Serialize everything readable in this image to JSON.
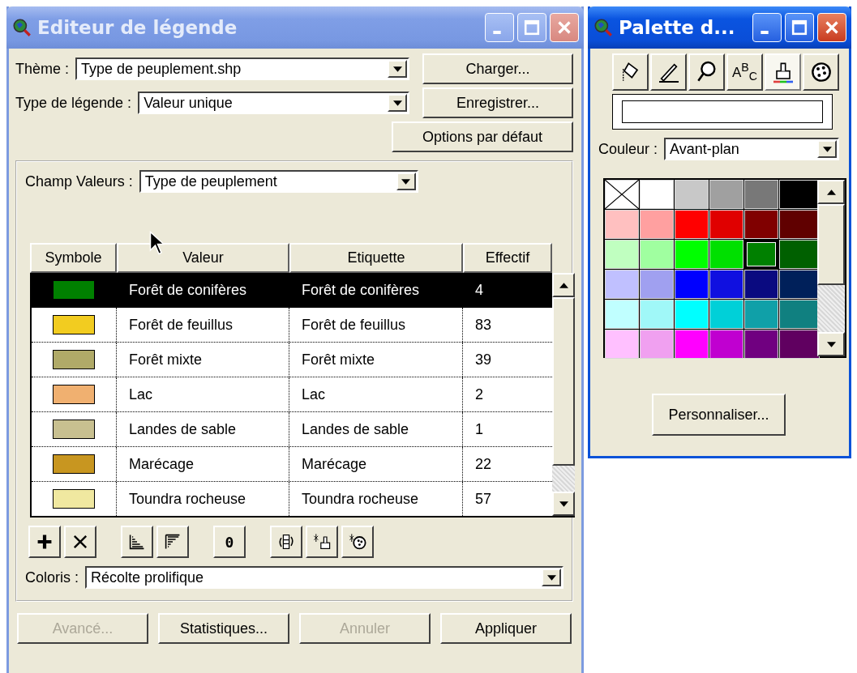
{
  "legend_editor": {
    "title": "Editeur de légende",
    "active": false,
    "theme": {
      "label": "Thème :",
      "value": "Type de peuplement.shp"
    },
    "legend_type": {
      "label": "Type de légende :",
      "value": "Valeur unique"
    },
    "side_buttons": [
      "Charger...",
      "Enregistrer...",
      "Options par défaut"
    ],
    "value_field": {
      "label": "Champ Valeurs :",
      "value": "Type de peuplement"
    },
    "table": {
      "columns": [
        "Symbole",
        "Valeur",
        "Etiquette",
        "Effectif"
      ],
      "rows": [
        {
          "color": "#008000",
          "value": "Forêt de conifères",
          "label": "Forêt de conifères",
          "count": "4",
          "selected": true
        },
        {
          "color": "#f2cc20",
          "value": "Forêt de feuillus",
          "label": "Forêt de feuillus",
          "count": "83",
          "selected": false
        },
        {
          "color": "#b0aa68",
          "value": "Forêt mixte",
          "label": "Forêt mixte",
          "count": "39",
          "selected": false
        },
        {
          "color": "#f0b070",
          "value": "Lac",
          "label": "Lac",
          "count": "2",
          "selected": false
        },
        {
          "color": "#c8c090",
          "value": "Landes de sable",
          "label": "Landes de sable",
          "count": "1",
          "selected": false
        },
        {
          "color": "#c89620",
          "value": "Marécage",
          "label": "Marécage",
          "count": "22",
          "selected": false
        },
        {
          "color": "#f0e8a0",
          "value": "Toundra rocheuse",
          "label": "Toundra rocheuse",
          "count": "57",
          "selected": false
        }
      ]
    },
    "null_button": "0",
    "color_scheme": {
      "label": "Coloris :",
      "value": "Récolte prolifique"
    },
    "buttons": [
      {
        "label": "Avancé...",
        "disabled": true
      },
      {
        "label": "Statistiques...",
        "disabled": false
      },
      {
        "label": "Annuler",
        "disabled": true
      },
      {
        "label": "Appliquer",
        "disabled": false
      }
    ]
  },
  "palette": {
    "title": "Palette d...",
    "active": true,
    "tools": [
      {
        "kind": "fill",
        "selected": false
      },
      {
        "kind": "pen",
        "selected": false
      },
      {
        "kind": "marker",
        "selected": false
      },
      {
        "kind": "text",
        "label": "A$^{B}$$_{C}$",
        "selected": false
      },
      {
        "kind": "color",
        "selected": true
      },
      {
        "kind": "palette",
        "selected": false
      }
    ],
    "color_field": {
      "label": "Couleur :",
      "value": "Avant-plan"
    },
    "swatches": [
      {
        "kind": "none",
        "selected": false
      },
      {
        "color": "#ffffff",
        "selected": false
      },
      {
        "color": "#c8c8c8",
        "selected": false
      },
      {
        "color": "#a0a0a0",
        "selected": false
      },
      {
        "color": "#787878",
        "selected": false
      },
      {
        "color": "#000000",
        "selected": false
      },
      {
        "color": "#ffc0c0",
        "selected": false
      },
      {
        "color": "#ffa0a0",
        "selected": false
      },
      {
        "color": "#ff0000",
        "selected": false
      },
      {
        "color": "#e00000",
        "selected": false
      },
      {
        "color": "#800000",
        "selected": false
      },
      {
        "color": "#600000",
        "selected": false
      },
      {
        "color": "#c0ffc0",
        "selected": false
      },
      {
        "color": "#a0ffa0",
        "selected": false
      },
      {
        "color": "#00ff00",
        "selected": false
      },
      {
        "color": "#00e000",
        "selected": false
      },
      {
        "color": "#008000",
        "selected": true
      },
      {
        "color": "#006000",
        "selected": false
      },
      {
        "color": "#c0c0ff",
        "selected": false
      },
      {
        "color": "#a0a0f0",
        "selected": false
      },
      {
        "color": "#0000ff",
        "selected": false
      },
      {
        "color": "#1010e0",
        "selected": false
      },
      {
        "color": "#0a0a80",
        "selected": false
      },
      {
        "color": "#00205a",
        "selected": false
      },
      {
        "color": "#c0ffff",
        "selected": false
      },
      {
        "color": "#a0f8f8",
        "selected": false
      },
      {
        "color": "#00ffff",
        "selected": false
      },
      {
        "color": "#00d0d8",
        "selected": false
      },
      {
        "color": "#10a0a8",
        "selected": false
      },
      {
        "color": "#108080",
        "selected": false
      },
      {
        "color": "#ffc0ff",
        "selected": false
      },
      {
        "color": "#f0a0f0",
        "selected": false
      },
      {
        "color": "#ff00ff",
        "selected": false
      },
      {
        "color": "#c000d0",
        "selected": false
      },
      {
        "color": "#700080",
        "selected": false
      },
      {
        "color": "#600060",
        "selected": false
      }
    ],
    "button": "Personnaliser..."
  }
}
